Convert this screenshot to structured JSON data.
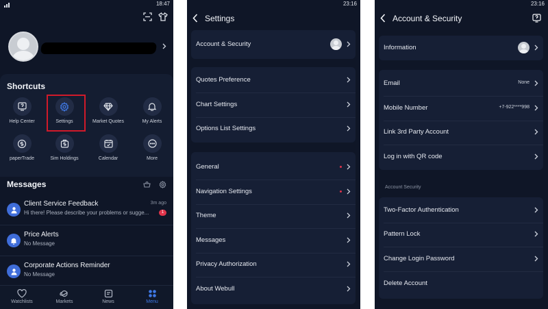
{
  "phone1": {
    "status_time": "18:47",
    "shortcuts_title": "Shortcuts",
    "shortcuts": [
      {
        "label": "Help Center",
        "icon": "help-center-icon"
      },
      {
        "label": "Settings",
        "icon": "gear-icon"
      },
      {
        "label": "Market Quotes",
        "icon": "diamond-icon"
      },
      {
        "label": "My Alerts",
        "icon": "bell-icon"
      },
      {
        "label": "paperTrade",
        "icon": "paper-trade-icon"
      },
      {
        "label": "Sim Holdings",
        "icon": "bag-icon"
      },
      {
        "label": "Calendar",
        "icon": "calendar-icon"
      },
      {
        "label": "More",
        "icon": "more-icon"
      }
    ],
    "messages_title": "Messages",
    "messages": [
      {
        "title": "Client Service Feedback",
        "subtitle": "Hi there! Please describe your problems or sugge...",
        "time": "3m ago",
        "badge": "1"
      },
      {
        "title": "Price Alerts",
        "subtitle": "No Message"
      },
      {
        "title": "Corporate Actions Reminder",
        "subtitle": "No Message"
      }
    ],
    "tabs": [
      {
        "label": "Watchlists"
      },
      {
        "label": "Markets"
      },
      {
        "label": "News"
      },
      {
        "label": "Menu",
        "active": true
      }
    ],
    "accent_color": "#3f79e6",
    "highlight_color": "#d11a2a"
  },
  "phone2": {
    "status_time": "23:16",
    "title": "Settings",
    "group1": [
      {
        "label": "Account & Security"
      }
    ],
    "group2": [
      {
        "label": "Quotes Preference"
      },
      {
        "label": "Chart Settings"
      },
      {
        "label": "Options List Settings"
      }
    ],
    "group3": [
      {
        "label": "General",
        "dot": true
      },
      {
        "label": "Navigation Settings",
        "dot": true
      },
      {
        "label": "Theme"
      },
      {
        "label": "Messages"
      },
      {
        "label": "Privacy Authorization"
      },
      {
        "label": "About Webull"
      }
    ]
  },
  "phone3": {
    "status_time": "23:16",
    "title": "Account & Security",
    "group1": [
      {
        "label": "Information"
      }
    ],
    "group2": [
      {
        "label": "Email",
        "value": "None"
      },
      {
        "label": "Mobile Number",
        "value": "+7-922****998"
      },
      {
        "label": "Link 3rd Party Account"
      },
      {
        "label": "Log in with QR code"
      }
    ],
    "security_label": "Account Security",
    "group3": [
      {
        "label": "Two-Factor Authentication"
      },
      {
        "label": "Pattern Lock"
      },
      {
        "label": "Change Login Password"
      },
      {
        "label": "Delete Account"
      }
    ]
  }
}
